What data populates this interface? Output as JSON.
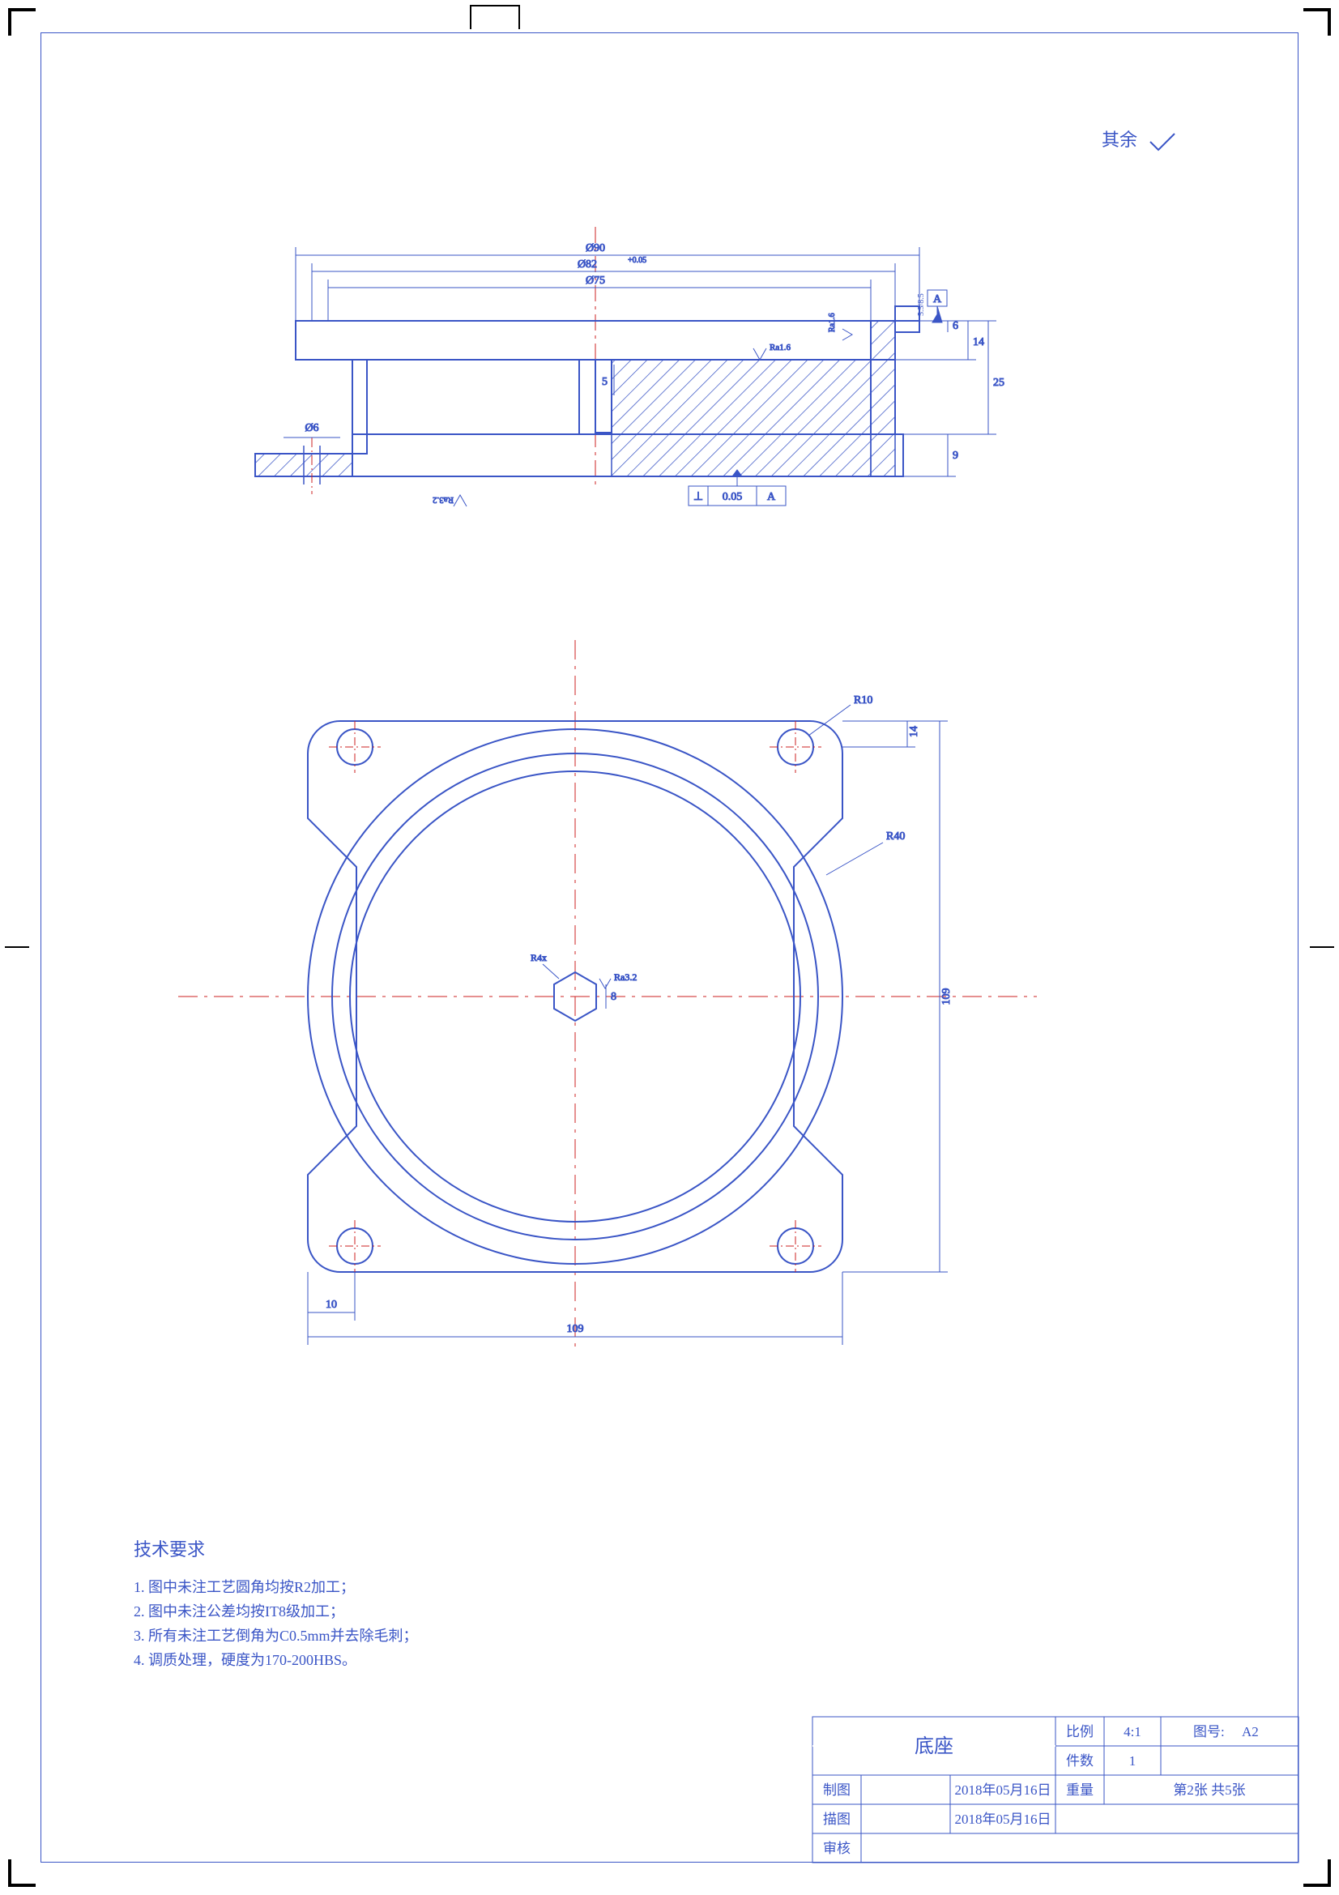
{
  "corner_note": "其余",
  "section": {
    "dims": {
      "d90": "Ø90",
      "d82": "Ø82",
      "d82tol": "+0.05",
      "d75": "Ø75",
      "d6": "Ø6",
      "h5": "5",
      "h6": "6",
      "h14": "14",
      "h25": "25",
      "h9": "9",
      "gtol": "⊥ 0.05 A",
      "datum": "A",
      "ra16": "Ra1.6",
      "ra16b": "Ra1.6",
      "ra32": "Ra3.2",
      "rmin": "5.5/8.5"
    }
  },
  "plan": {
    "dims": {
      "w109": "109",
      "h109": "109",
      "off10": "10",
      "off14": "14",
      "r10": "R10",
      "r40": "R40",
      "h8": "8",
      "ra32": "Ra3.2",
      "r4x": "R4x"
    }
  },
  "notes": {
    "heading": "技术要求",
    "n1": "1. 图中未注工艺圆角均按R2加工；",
    "n2": "2. 图中未注公差均按IT8级加工；",
    "n3": "3. 所有未注工艺倒角为C0.5mm并去除毛刺；",
    "n4": "4. 调质处理，硬度为170-200HBS。"
  },
  "title_block": {
    "part_name": "底座",
    "scale_label": "比例",
    "scale_value": "4:1",
    "sheet_label": "图号:",
    "sheet_value": "A2",
    "qty_label": "件数",
    "qty_value": "1",
    "drawn_label": "制图",
    "drawn_date": "2018年05月16日",
    "mass_label": "重量",
    "page": "第2张  共5张",
    "traced_label": "描图",
    "traced_date": "2018年05月16日",
    "checked_label": "审核"
  }
}
